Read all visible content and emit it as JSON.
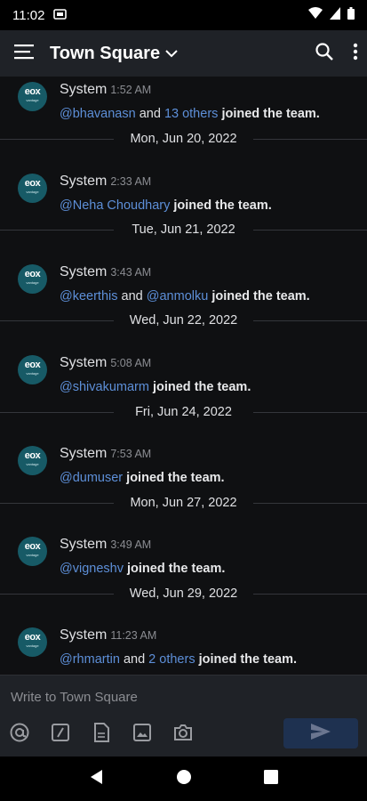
{
  "status_bar": {
    "time": "11:02"
  },
  "header": {
    "channel_name": "Town Square"
  },
  "posts": [
    {
      "author": "System",
      "time": "1:52 AM",
      "mention1": "@bhavanasn",
      "joiner": "and",
      "mention2": "13 others",
      "text": "joined the team."
    },
    {
      "date": "Mon, Jun 20, 2022"
    },
    {
      "author": "System",
      "time": "2:33 AM",
      "mention1": "@Neha Choudhary",
      "text": "joined the team."
    },
    {
      "date": "Tue, Jun 21, 2022"
    },
    {
      "author": "System",
      "time": "3:43 AM",
      "mention1": "@keerthis",
      "joiner": "and",
      "mention2": "@anmolku",
      "text": "joined the team."
    },
    {
      "date": "Wed, Jun 22, 2022"
    },
    {
      "author": "System",
      "time": "5:08 AM",
      "mention1": "@shivakumarm",
      "text": "joined the team."
    },
    {
      "date": "Fri, Jun 24, 2022"
    },
    {
      "author": "System",
      "time": "7:53 AM",
      "mention1": "@dumuser",
      "text": "joined the team."
    },
    {
      "date": "Mon, Jun 27, 2022"
    },
    {
      "author": "System",
      "time": "3:49 AM",
      "mention1": "@vigneshv",
      "text": "joined the team."
    },
    {
      "date": "Wed, Jun 29, 2022"
    },
    {
      "author": "System",
      "time": "11:23 AM",
      "mention1": "@rhmartin",
      "joiner": "and",
      "mention2": "2 others",
      "text": "joined the team."
    }
  ],
  "avatar": {
    "logo": "eox",
    "sub": "vantage"
  },
  "composer": {
    "placeholder": "Write to Town Square"
  },
  "icons": [
    "menu-icon",
    "chevron-down-icon",
    "search-icon",
    "more-vertical-icon",
    "at-icon",
    "slash-icon",
    "file-icon",
    "image-icon",
    "camera-icon",
    "send-icon",
    "back-icon",
    "home-icon",
    "recents-icon"
  ],
  "colors": {
    "mention": "#5d8fd8",
    "background": "#0f1012",
    "header": "#1f2227",
    "send_button": "#1e3150"
  }
}
